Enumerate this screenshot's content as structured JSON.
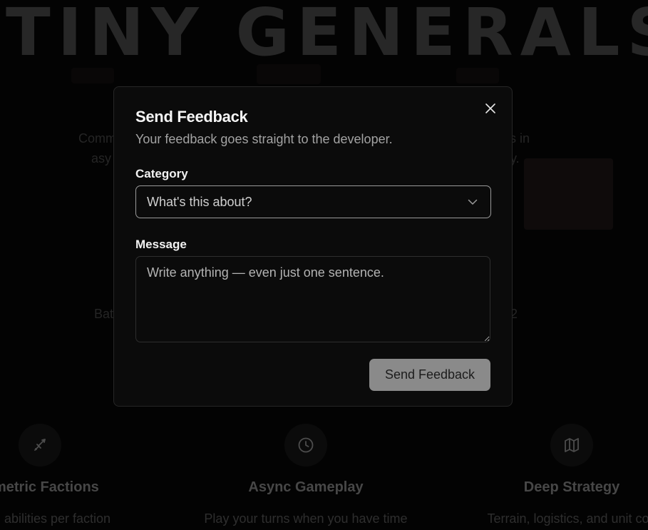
{
  "background": {
    "hero_title": "TINY GENERALS",
    "left_text_1": "Comm",
    "left_text_2": "asy",
    "right_text_1": "s in",
    "right_text_2": "y.",
    "left_label": "Bat",
    "right_label": "2",
    "features": [
      {
        "icon": "sword-icon",
        "title": "mmetric Factions",
        "desc": "s and abilities per faction"
      },
      {
        "icon": "clock-icon",
        "title": "Async Gameplay",
        "desc": "Play your turns when you have time"
      },
      {
        "icon": "map-icon",
        "title": "Deep Strategy",
        "desc": "Terrain, logistics, and unit cou"
      }
    ]
  },
  "modal": {
    "title": "Send Feedback",
    "description": "Your feedback goes straight to the developer.",
    "close_icon": "close-icon",
    "category_label": "Category",
    "category_placeholder": "What's this about?",
    "message_label": "Message",
    "message_placeholder": "Write anything — even just one sentence.",
    "message_value": "",
    "submit_label": "Send Feedback"
  },
  "colors": {
    "background": "#050505",
    "modal_bg": "#0b0b0b",
    "button_bg": "#8a8a8a"
  }
}
